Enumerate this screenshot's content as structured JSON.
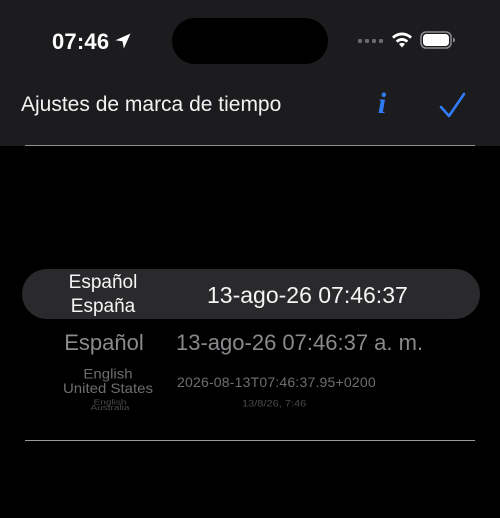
{
  "status_bar": {
    "time": "07:46",
    "location_icon": "location-arrow-icon",
    "signal_icon": "cellular-signal-icon",
    "wifi_icon": "wifi-icon",
    "battery_icon": "battery-full-icon"
  },
  "nav": {
    "title": "Ajustes de marca de tiempo",
    "info_label": "i",
    "done_icon": "checkmark-icon"
  },
  "colors": {
    "accent": "#2f7cf6",
    "panel": "#1c1c1e",
    "background": "#000000"
  },
  "picker": {
    "rows": [
      {
        "lang": "Español\nEspaña",
        "timestamp": "13-ago-26 07:46:37"
      },
      {
        "lang": "Español",
        "timestamp": "13-ago-26 07:46:37 a. m."
      },
      {
        "lang": "English\nUnited States",
        "timestamp": "2026-08-13T07:46:37.95+0200"
      },
      {
        "lang": "English\nAustralia",
        "timestamp": "13/8/26, 7:46"
      }
    ]
  }
}
